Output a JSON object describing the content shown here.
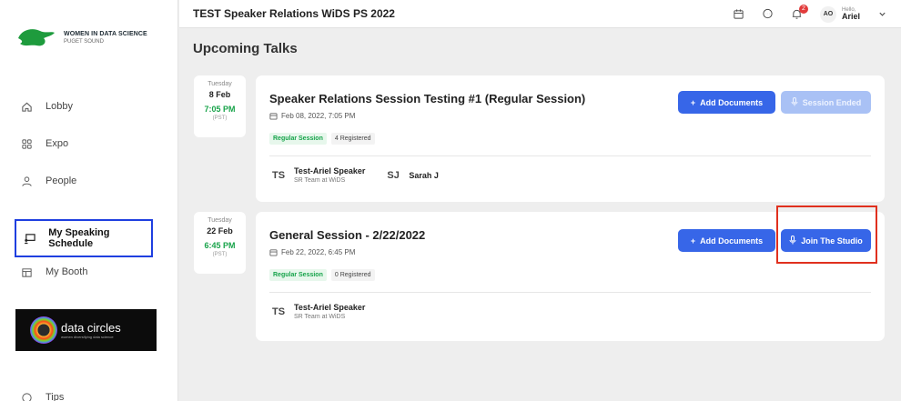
{
  "sidebar": {
    "logo": {
      "line1": "WOMEN IN DATA SCIENCE",
      "line2": "PUGET SOUND"
    },
    "items": [
      {
        "label": "Lobby",
        "icon": "home-icon"
      },
      {
        "label": "Expo",
        "icon": "grid-icon"
      },
      {
        "label": "People",
        "icon": "person-icon"
      },
      {
        "label": "My Speaking Schedule",
        "icon": "presentation-icon"
      },
      {
        "label": "My Booth",
        "icon": "booth-icon"
      }
    ],
    "sponsor": {
      "brand": "data circles",
      "tagline": "women diversifying data science"
    },
    "partial_item": "Tips"
  },
  "topbar": {
    "title": "TEST Speaker Relations WiDS PS 2022",
    "notification_count": "2",
    "avatar_initials": "AO",
    "greeting": "Hello,",
    "user_name": "Ariel"
  },
  "heading": "Upcoming Talks",
  "sessions": [
    {
      "day": "Tuesday",
      "date": "8 Feb",
      "time": "7:05 PM",
      "tz": "(PST)",
      "title": "Speaker Relations Session Testing #1 (Regular Session)",
      "datetime": "Feb 08, 2022, 7:05 PM",
      "type": "Regular Session",
      "registered": "4 Registered",
      "speakers": [
        {
          "initials": "TS",
          "name": "Test-Ariel Speaker",
          "role": "SR Team at WiDS"
        },
        {
          "initials": "SJ",
          "name": "Sarah J",
          "role": ""
        }
      ],
      "add_docs": "Add Documents",
      "status_btn": "Session Ended"
    },
    {
      "day": "Tuesday",
      "date": "22 Feb",
      "time": "6:45 PM",
      "tz": "(PST)",
      "title": "General Session - 2/22/2022",
      "datetime": "Feb 22, 2022, 6:45 PM",
      "type": "Regular Session",
      "registered": "0 Registered",
      "speakers": [
        {
          "initials": "TS",
          "name": "Test-Ariel Speaker",
          "role": "SR Team at WiDS"
        }
      ],
      "add_docs": "Add Documents",
      "status_btn": "Join The Studio"
    }
  ],
  "colors": {
    "primary": "#3766e8",
    "green": "#16a34a",
    "highlight_blue": "#1f3fe0",
    "highlight_red": "#e0301e"
  }
}
